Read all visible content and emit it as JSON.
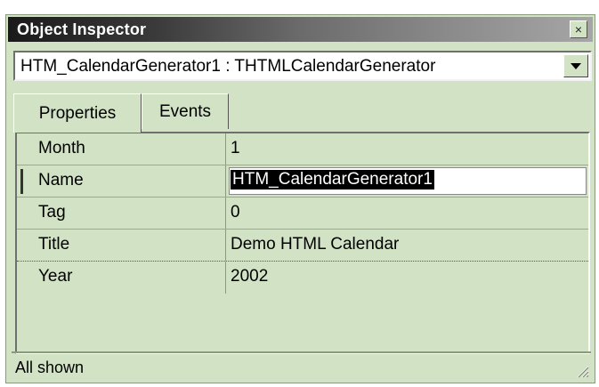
{
  "window": {
    "title": "Object Inspector",
    "close_glyph": "×"
  },
  "selector": {
    "value": "HTM_CalendarGenerator1 : THTMLCalendarGenerator",
    "dropdown_icon": "triangle-down-icon"
  },
  "tabs": [
    {
      "label": "Properties",
      "active": true
    },
    {
      "label": "Events",
      "active": false
    }
  ],
  "properties": [
    {
      "name": "Month",
      "value": "1"
    },
    {
      "name": "Name",
      "value": "HTM_CalendarGenerator1",
      "selected": true
    },
    {
      "name": "Tag",
      "value": "0"
    },
    {
      "name": "Title",
      "value": "Demo HTML Calendar"
    },
    {
      "name": "Year",
      "value": "2002"
    }
  ],
  "status": {
    "text": "All shown"
  },
  "colors": {
    "background": "#d2e3c5",
    "title_dark": "#1a1a1a",
    "selection": "#000000"
  }
}
